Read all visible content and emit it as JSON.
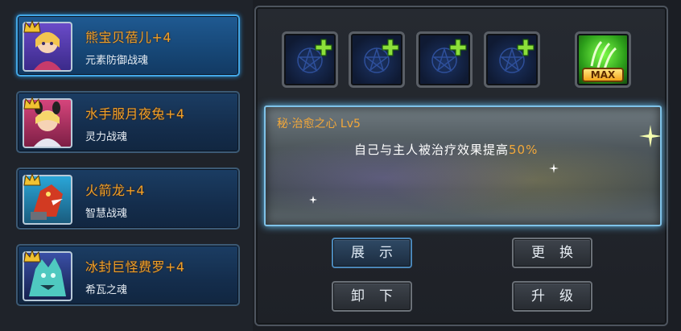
{
  "pets": [
    {
      "name": "熊宝贝蓓儿+4",
      "type": "元素防御战魂",
      "selected": true,
      "icon": "girl-pet-portrait-icon"
    },
    {
      "name": "水手服月夜兔+4",
      "type": "灵力战魂",
      "selected": false,
      "icon": "bunny-girl-portrait-icon"
    },
    {
      "name": "火箭龙+4",
      "type": "智慧战魂",
      "selected": false,
      "icon": "rocket-dragon-portrait-icon"
    },
    {
      "name": "冰封巨怪费罗+4",
      "type": "希瓦之魂",
      "selected": false,
      "icon": "ice-monster-portrait-icon"
    }
  ],
  "slots": [
    {
      "icon": "pentagram-add-slot-icon"
    },
    {
      "icon": "pentagram-add-slot-icon"
    },
    {
      "icon": "pentagram-add-slot-icon"
    },
    {
      "icon": "pentagram-add-slot-icon"
    }
  ],
  "max_slot": {
    "label": "MAX",
    "icon": "green-claw-skill-icon"
  },
  "skill": {
    "title": "秘·治愈之心 Lv5",
    "desc_prefix": "自己与主人被治疗效果提高",
    "desc_value": "50%"
  },
  "buttons": {
    "show": "展示",
    "change": "更换",
    "unload": "卸下",
    "upgrade": "升级"
  },
  "colors": {
    "accent_orange": "#f3a83a",
    "selected_border": "#43a7e6",
    "banner_glow": "#69c3f4"
  }
}
